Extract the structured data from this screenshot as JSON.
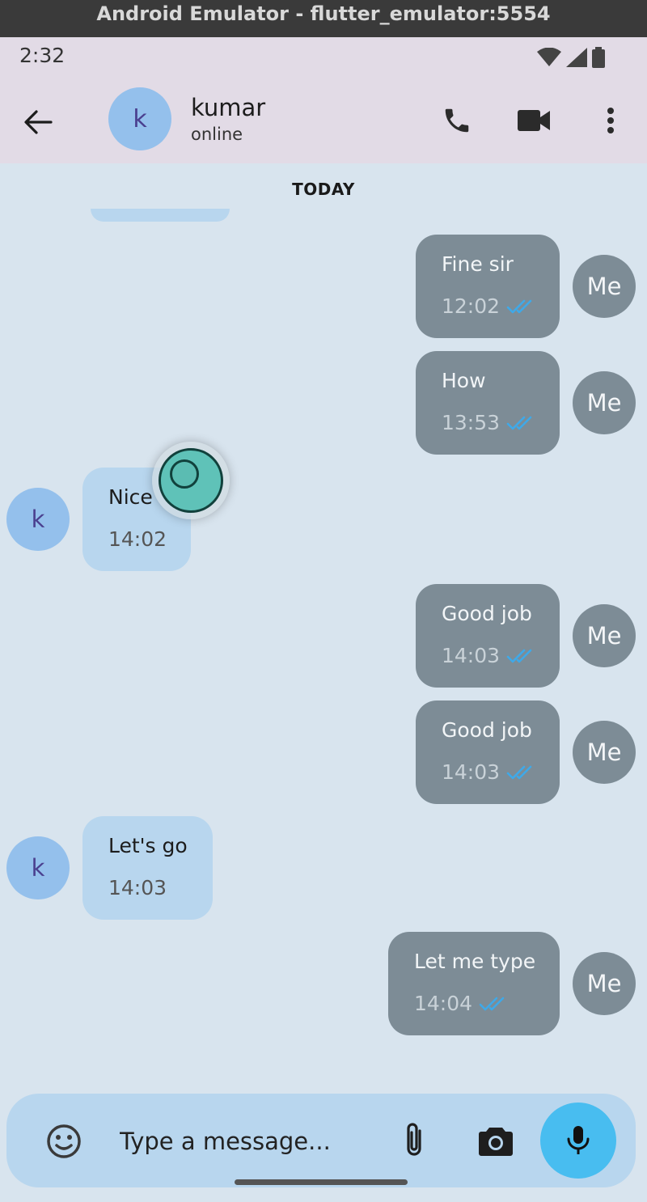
{
  "window": {
    "title": "Android Emulator - flutter_emulator:5554"
  },
  "status_bar": {
    "time": "2:32",
    "icons": [
      "wifi-icon",
      "cell-signal-icon",
      "battery-icon"
    ]
  },
  "header": {
    "contact_initial": "k",
    "contact_name": "kumar",
    "contact_status": "online",
    "icons": [
      "back-arrow-icon",
      "phone-icon",
      "video-icon",
      "more-vert-icon"
    ]
  },
  "chat": {
    "date_label": "TODAY",
    "me_avatar_label": "Me",
    "contact_avatar_label": "k",
    "messages": [
      {
        "direction": "out",
        "text": "Fine sir",
        "time": "12:02",
        "read": true
      },
      {
        "direction": "out",
        "text": "How",
        "time": "13:53",
        "read": true
      },
      {
        "direction": "in",
        "text": "Nice",
        "time": "14:02"
      },
      {
        "direction": "out",
        "text": "Good job",
        "time": "14:03",
        "read": true
      },
      {
        "direction": "out",
        "text": "Good job",
        "time": "14:03",
        "read": true
      },
      {
        "direction": "in",
        "text": "Let's go",
        "time": "14:03"
      },
      {
        "direction": "out",
        "text": "Let me type",
        "time": "14:04",
        "read": true
      }
    ]
  },
  "composer": {
    "placeholder": "Type a message...",
    "icons": [
      "emoji-icon",
      "attach-icon",
      "camera-icon",
      "mic-icon"
    ]
  },
  "colors": {
    "status_bar_bg": "#e2dbe6",
    "chat_bg": "#d8e4ee",
    "outgoing_bubble": "#7d8c96",
    "incoming_bubble": "#b8d6ee",
    "read_ticks": "#3fa9e8",
    "mic_button": "#48bdf0"
  }
}
